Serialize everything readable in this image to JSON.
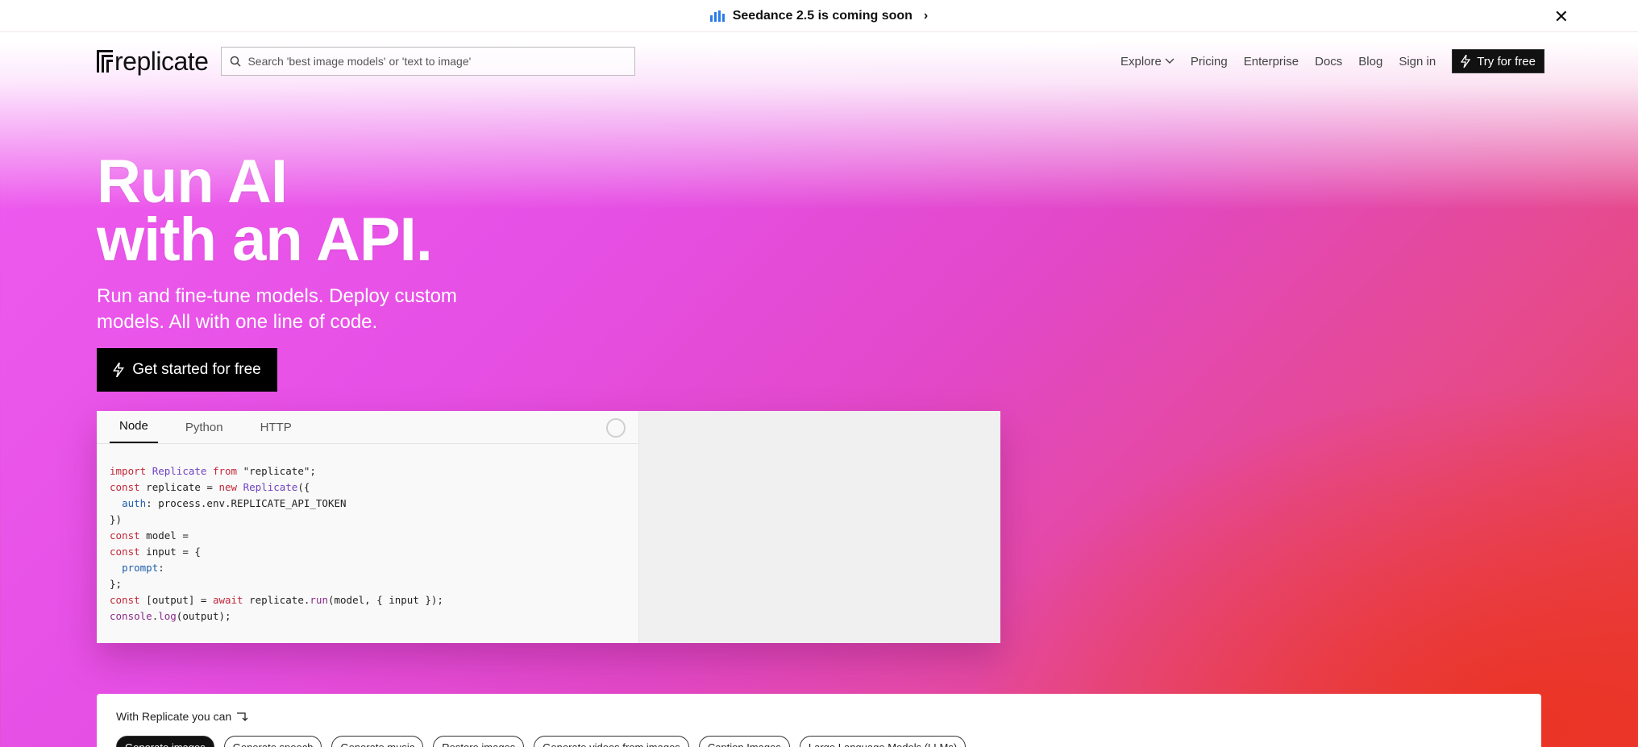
{
  "announcement": {
    "text": "Seedance 2.5 is coming soon",
    "icon": "bar-chart-icon",
    "accent": "#2b7de9"
  },
  "header": {
    "logo_text": "replicate",
    "search_placeholder": "Search 'best image models' or 'text to image'",
    "nav": {
      "explore": "Explore",
      "pricing": "Pricing",
      "enterprise": "Enterprise",
      "docs": "Docs",
      "blog": "Blog",
      "sign_in": "Sign in",
      "try_free": "Try for free"
    }
  },
  "hero": {
    "title_line1": "Run AI",
    "title_line2": "with an API.",
    "subtitle": "Run and fine-tune models. Deploy custom models. All with one line of code.",
    "cta": "Get started for free"
  },
  "code_panel": {
    "tabs": [
      "Node",
      "Python",
      "HTTP"
    ],
    "active_tab": "Node",
    "lines": [
      "import Replicate from \"replicate\";",
      "const replicate = new Replicate({",
      "  auth: process.env.REPLICATE_API_TOKEN",
      "})",
      "const model =",
      "const input = {",
      "  prompt:",
      "};",
      "const [output] = await replicate.run(model, { input });",
      "console.log(output);"
    ]
  },
  "capabilities": {
    "label": "With Replicate you can",
    "chips": [
      "Generate images",
      "Generate speech",
      "Generate music",
      "Restore images",
      "Generate videos from images",
      "Caption Images",
      "Large Language Models (LLMs)"
    ],
    "active_chip": "Generate images"
  },
  "colors": {
    "pink": "#ef5cf0",
    "magenta": "#e248c8",
    "red": "#ea3424",
    "dark": "#111111"
  }
}
